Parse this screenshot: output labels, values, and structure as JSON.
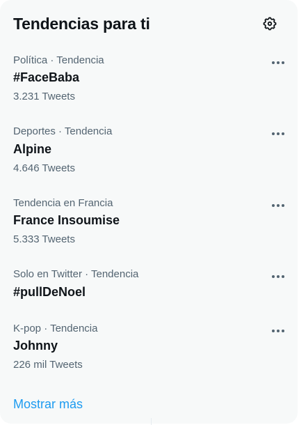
{
  "header": {
    "title": "Tendencias para ti",
    "settings_icon": "gear-icon"
  },
  "trends": [
    {
      "meta": "Política · Tendencia",
      "name": "#FaceBaba",
      "count": "3.231 Tweets"
    },
    {
      "meta": "Deportes · Tendencia",
      "name": "Alpine",
      "count": "4.646 Tweets"
    },
    {
      "meta": "Tendencia en Francia",
      "name": "France Insoumise",
      "count": "5.333 Tweets"
    },
    {
      "meta": "Solo en Twitter · Tendencia",
      "name": "#pullDeNoel",
      "count": ""
    },
    {
      "meta": "K-pop · Tendencia",
      "name": "Johnny",
      "count": "226 mil Tweets"
    }
  ],
  "footer": {
    "show_more": "Mostrar más"
  },
  "colors": {
    "background": "#f7f9f9",
    "primary_text": "#0f1419",
    "secondary_text": "#536471",
    "accent": "#1d9bf0"
  }
}
